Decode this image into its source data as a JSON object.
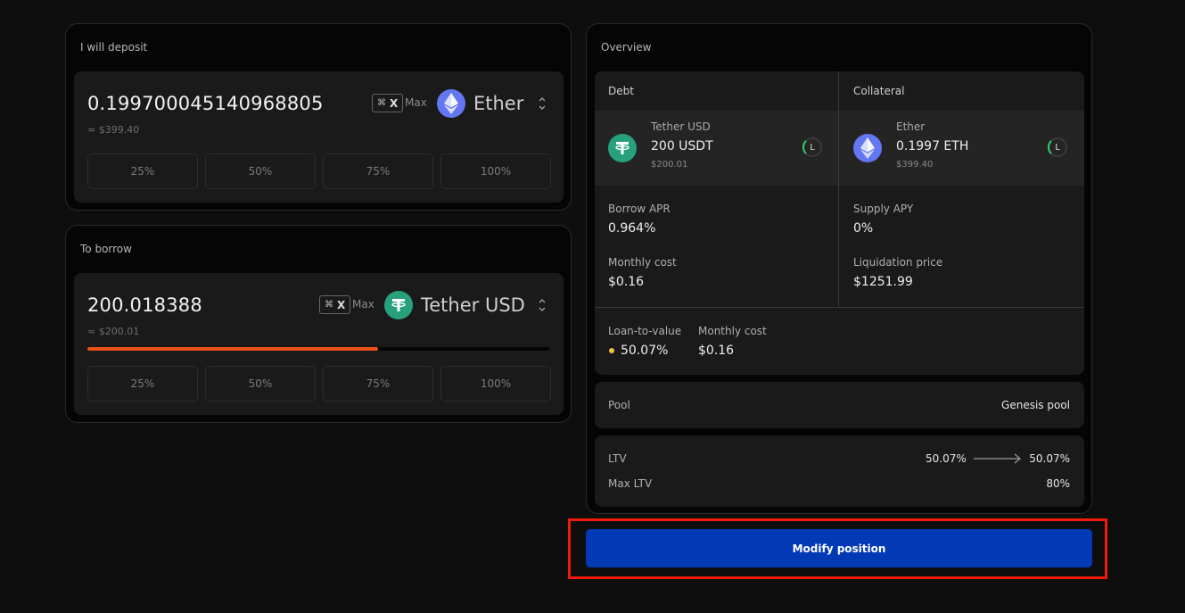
{
  "deposit": {
    "title": "I will deposit",
    "amount": "0.199700045140968805",
    "usd": "≈ $399.40",
    "shortcut_symbol": "⌘",
    "shortcut_key": "X",
    "max_label": "Max",
    "token": "Ether",
    "percents": [
      "25%",
      "50%",
      "75%",
      "100%"
    ]
  },
  "borrow": {
    "title": "To borrow",
    "amount": "200.018388",
    "usd": "≈ $200.01",
    "shortcut_symbol": "⌘",
    "shortcut_key": "X",
    "max_label": "Max",
    "token": "Tether USD",
    "progress_fraction": 0.63,
    "percents": [
      "25%",
      "50%",
      "75%",
      "100%"
    ]
  },
  "overview": {
    "title": "Overview",
    "debt": {
      "header": "Debt",
      "token_name": "Tether USD",
      "amount": "200 USDT",
      "usd": "$200.01",
      "badge": "L"
    },
    "collateral": {
      "header": "Collateral",
      "token_name": "Ether",
      "amount": "0.1997 ETH",
      "usd": "$399.40",
      "badge": "L"
    },
    "borrow_apr_label": "Borrow APR",
    "borrow_apr": "0.964%",
    "monthly_cost_label": "Monthly cost",
    "monthly_cost": "$0.16",
    "supply_apy_label": "Supply APY",
    "supply_apy": "0%",
    "liq_price_label": "Liquidation price",
    "liq_price": "$1251.99",
    "ltv_label": "Loan-to-value",
    "ltv_value": "50.07%",
    "monthly_cost2_label": "Monthly cost",
    "monthly_cost2": "$0.16",
    "pool_label": "Pool",
    "pool_value": "Genesis pool",
    "ltv_row_label": "LTV",
    "ltv_from": "50.07%",
    "ltv_to": "50.07%",
    "max_ltv_label": "Max LTV",
    "max_ltv": "80%"
  },
  "action": {
    "modify_label": "Modify position"
  },
  "colors": {
    "accent_button": "#023ab6",
    "progress": "#e8501a",
    "highlight": "#f01a0a",
    "eth": "#6377f0",
    "usdt": "#26a17b"
  }
}
